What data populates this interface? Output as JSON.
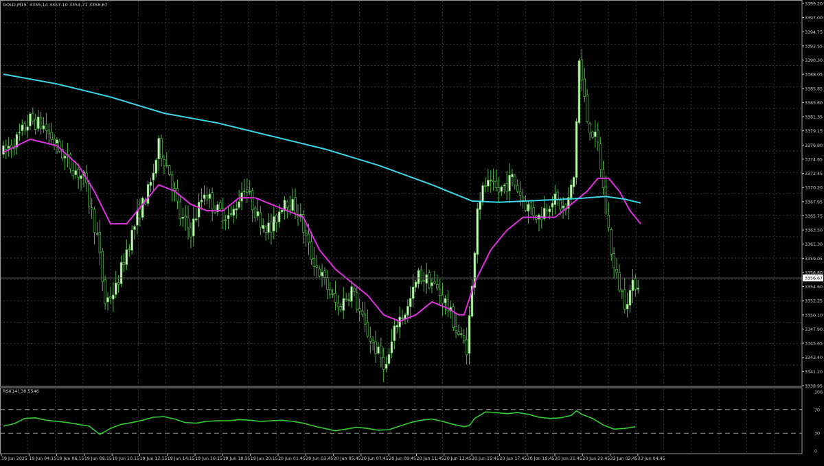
{
  "symbol_header": {
    "symbol": "GOLD,M15",
    "ohlc": "3355.14 3357.10 3354.71 3356.67"
  },
  "indicator_header": {
    "name": "RSI(14)",
    "value": "38.5546"
  },
  "current_price_label": "3356.67",
  "colors": {
    "background": "#000000",
    "grid": "#3a3a3a",
    "candle": "#d6f5c8",
    "candle_edge": "#52b848",
    "ma_fast": "#e030e0",
    "ma_slow": "#3ad7e8",
    "rsi_line": "#32cd32",
    "axis_text": "#d0d0d0"
  },
  "chart_data": [
    {
      "type": "candlestick",
      "title": "GOLD,M15",
      "timeframe": "M15",
      "ylim": [
        3340.0,
        3399.2
      ],
      "y_ticks": [
        "3399.20",
        "3397.00",
        "3394.75",
        "3392.55",
        "3390.30",
        "3388.05",
        "3385.85",
        "3383.60",
        "3381.35",
        "3379.15",
        "3376.90",
        "3374.65",
        "3372.45",
        "3370.20",
        "3367.95",
        "3365.75",
        "3363.50",
        "3361.30",
        "3359.05",
        "3356.80",
        "3354.60",
        "3352.25",
        "3350.10",
        "3347.90",
        "3345.65",
        "3343.40",
        "3341.20",
        "3338.95"
      ],
      "x_ticks": [
        "19 Jun 2025",
        "19 Jun 04:15",
        "19 Jun 06:15",
        "19 Jun 08:15",
        "19 Jun 10:15",
        "19 Jun 12:15",
        "19 Jun 14:15",
        "19 Jun 16:15",
        "19 Jun 18:15",
        "19 Jun 20:15",
        "20 Jun 01:45",
        "20 Jun 03:45",
        "20 Jun 05:45",
        "20 Jun 07:45",
        "20 Jun 09:45",
        "20 Jun 11:45",
        "20 Jun 13:45",
        "20 Jun 15:45",
        "20 Jun 17:45",
        "20 Jun 19:45",
        "20 Jun 21:45",
        "20 Jun 23:45",
        "23 Jun 02:45",
        "23 Jun 04:45"
      ],
      "last_price": 3356.67,
      "last_bar": {
        "open": 3355.14,
        "high": 3357.1,
        "low": 3354.71,
        "close": 3356.67
      },
      "price_path": [
        [
          0,
          3376
        ],
        [
          5,
          3378
        ],
        [
          10,
          3381
        ],
        [
          15,
          3380
        ],
        [
          20,
          3377
        ],
        [
          25,
          3374
        ],
        [
          30,
          3372
        ],
        [
          35,
          3363
        ],
        [
          38,
          3353
        ],
        [
          42,
          3355
        ],
        [
          46,
          3361
        ],
        [
          50,
          3366
        ],
        [
          55,
          3371
        ],
        [
          58,
          3377
        ],
        [
          62,
          3373
        ],
        [
          66,
          3366
        ],
        [
          70,
          3364
        ],
        [
          75,
          3370
        ],
        [
          80,
          3367
        ],
        [
          85,
          3366
        ],
        [
          90,
          3371
        ],
        [
          95,
          3366
        ],
        [
          100,
          3364
        ],
        [
          105,
          3369
        ],
        [
          110,
          3367
        ],
        [
          115,
          3360
        ],
        [
          120,
          3356
        ],
        [
          125,
          3352
        ],
        [
          130,
          3355
        ],
        [
          135,
          3349
        ],
        [
          140,
          3345
        ],
        [
          143,
          3343
        ],
        [
          147,
          3350
        ],
        [
          151,
          3352
        ],
        [
          155,
          3357
        ],
        [
          160,
          3356
        ],
        [
          165,
          3353
        ],
        [
          170,
          3348
        ],
        [
          173,
          3346
        ],
        [
          175,
          3355
        ],
        [
          177,
          3368
        ],
        [
          180,
          3371
        ],
        [
          185,
          3370
        ],
        [
          190,
          3372
        ],
        [
          195,
          3368
        ],
        [
          200,
          3366
        ],
        [
          205,
          3369
        ],
        [
          210,
          3367
        ],
        [
          213,
          3372
        ],
        [
          215,
          3390
        ],
        [
          218,
          3381
        ],
        [
          222,
          3377
        ],
        [
          225,
          3367
        ],
        [
          228,
          3358
        ],
        [
          232,
          3353
        ],
        [
          236,
          3356
        ]
      ],
      "series": [
        {
          "name": "",
          "color": "#e030e0",
          "points": [
            [
              0,
              3376
            ],
            [
              10,
              3378
            ],
            [
              20,
              3377
            ],
            [
              28,
              3374
            ],
            [
              34,
              3370
            ],
            [
              40,
              3365
            ],
            [
              46,
              3365
            ],
            [
              52,
              3368
            ],
            [
              58,
              3371
            ],
            [
              64,
              3370
            ],
            [
              70,
              3368
            ],
            [
              76,
              3367
            ],
            [
              82,
              3367
            ],
            [
              88,
              3369
            ],
            [
              94,
              3369
            ],
            [
              100,
              3368
            ],
            [
              106,
              3367
            ],
            [
              112,
              3366
            ],
            [
              118,
              3361
            ],
            [
              124,
              3358
            ],
            [
              130,
              3356
            ],
            [
              136,
              3354
            ],
            [
              142,
              3351
            ],
            [
              148,
              3350
            ],
            [
              154,
              3351
            ],
            [
              160,
              3353
            ],
            [
              166,
              3352
            ],
            [
              170,
              3351
            ],
            [
              172,
              3351
            ],
            [
              176,
              3356
            ],
            [
              182,
              3361
            ],
            [
              188,
              3364
            ],
            [
              194,
              3366
            ],
            [
              200,
              3366
            ],
            [
              206,
              3366
            ],
            [
              212,
              3368
            ],
            [
              218,
              3370
            ],
            [
              222,
              3372
            ],
            [
              226,
              3372
            ],
            [
              230,
              3370
            ],
            [
              234,
              3367
            ],
            [
              238,
              3365
            ]
          ]
        },
        {
          "name": "",
          "color": "#3ad7e8",
          "points": [
            [
              0,
              3388
            ],
            [
              20,
              3386.5
            ],
            [
              40,
              3384.5
            ],
            [
              60,
              3382
            ],
            [
              80,
              3380.5
            ],
            [
              100,
              3378.5
            ],
            [
              120,
              3376.5
            ],
            [
              140,
              3374
            ],
            [
              160,
              3371
            ],
            [
              175,
              3368.5
            ],
            [
              185,
              3368.3
            ],
            [
              200,
              3368.6
            ],
            [
              215,
              3368.9
            ],
            [
              225,
              3369.2
            ],
            [
              232,
              3368.8
            ],
            [
              238,
              3368.2
            ]
          ]
        }
      ]
    },
    {
      "type": "line",
      "title": "RSI(14) 38.5546",
      "ylim": [
        0,
        100
      ],
      "y_ticks": [
        "100",
        "70",
        "30",
        "0"
      ],
      "levels": [
        70,
        30
      ],
      "series": [
        {
          "name": "RSI(14)",
          "color": "#32cd32",
          "points": [
            [
              0,
              42
            ],
            [
              4,
              46
            ],
            [
              8,
              55
            ],
            [
              12,
              56
            ],
            [
              16,
              52
            ],
            [
              20,
              50
            ],
            [
              24,
              48
            ],
            [
              28,
              45
            ],
            [
              32,
              42
            ],
            [
              36,
              28
            ],
            [
              40,
              38
            ],
            [
              44,
              45
            ],
            [
              48,
              48
            ],
            [
              52,
              52
            ],
            [
              56,
              57
            ],
            [
              60,
              58
            ],
            [
              64,
              54
            ],
            [
              68,
              48
            ],
            [
              72,
              47
            ],
            [
              76,
              50
            ],
            [
              80,
              51
            ],
            [
              84,
              51
            ],
            [
              88,
              53
            ],
            [
              92,
              52
            ],
            [
              96,
              50
            ],
            [
              100,
              51
            ],
            [
              104,
              52
            ],
            [
              108,
              50
            ],
            [
              112,
              47
            ],
            [
              116,
              42
            ],
            [
              120,
              38
            ],
            [
              124,
              34
            ],
            [
              128,
              37
            ],
            [
              132,
              40
            ],
            [
              136,
              38
            ],
            [
              140,
              35
            ],
            [
              144,
              36
            ],
            [
              148,
              42
            ],
            [
              152,
              48
            ],
            [
              156,
              52
            ],
            [
              160,
              54
            ],
            [
              164,
              50
            ],
            [
              168,
              45
            ],
            [
              172,
              41
            ],
            [
              174,
              43
            ],
            [
              176,
              55
            ],
            [
              180,
              66
            ],
            [
              184,
              65
            ],
            [
              188,
              63
            ],
            [
              192,
              65
            ],
            [
              196,
              62
            ],
            [
              200,
              57
            ],
            [
              204,
              55
            ],
            [
              208,
              56
            ],
            [
              212,
              60
            ],
            [
              214,
              68
            ],
            [
              216,
              62
            ],
            [
              220,
              55
            ],
            [
              224,
              44
            ],
            [
              228,
              37
            ],
            [
              232,
              38
            ],
            [
              236,
              41
            ]
          ]
        }
      ]
    }
  ]
}
